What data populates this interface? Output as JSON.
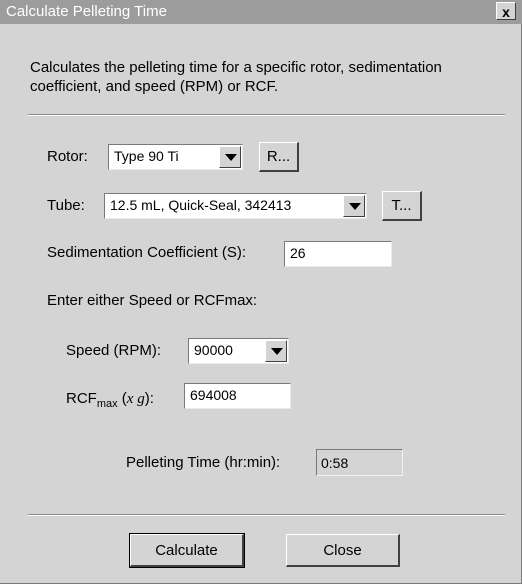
{
  "window": {
    "title": "Calculate Pelleting Time",
    "close_label": "x"
  },
  "description": "Calculates the pelleting time for a specific rotor, sedimentation coefficient, and speed (RPM) or RCF.",
  "rotor": {
    "label": "Rotor:",
    "value": "Type 90 Ti",
    "button_label": "R..."
  },
  "tube": {
    "label": "Tube:",
    "value": "12.5 mL, Quick-Seal, 342413",
    "button_label": "T..."
  },
  "sedimentation": {
    "label": "Sedimentation Coefficient (S):",
    "value": "26"
  },
  "instruction": "Enter either Speed or RCFmax:",
  "speed": {
    "label": "Speed (RPM):",
    "value": "90000"
  },
  "rcf": {
    "label_main": "RCF",
    "label_sub": "max",
    "label_open": " (",
    "label_x": "x g",
    "label_close": "):",
    "value": "694008"
  },
  "pelleting": {
    "label": "Pelleting Time (hr:min):",
    "value": "0:58"
  },
  "buttons": {
    "calculate": "Calculate",
    "close": "Close"
  }
}
